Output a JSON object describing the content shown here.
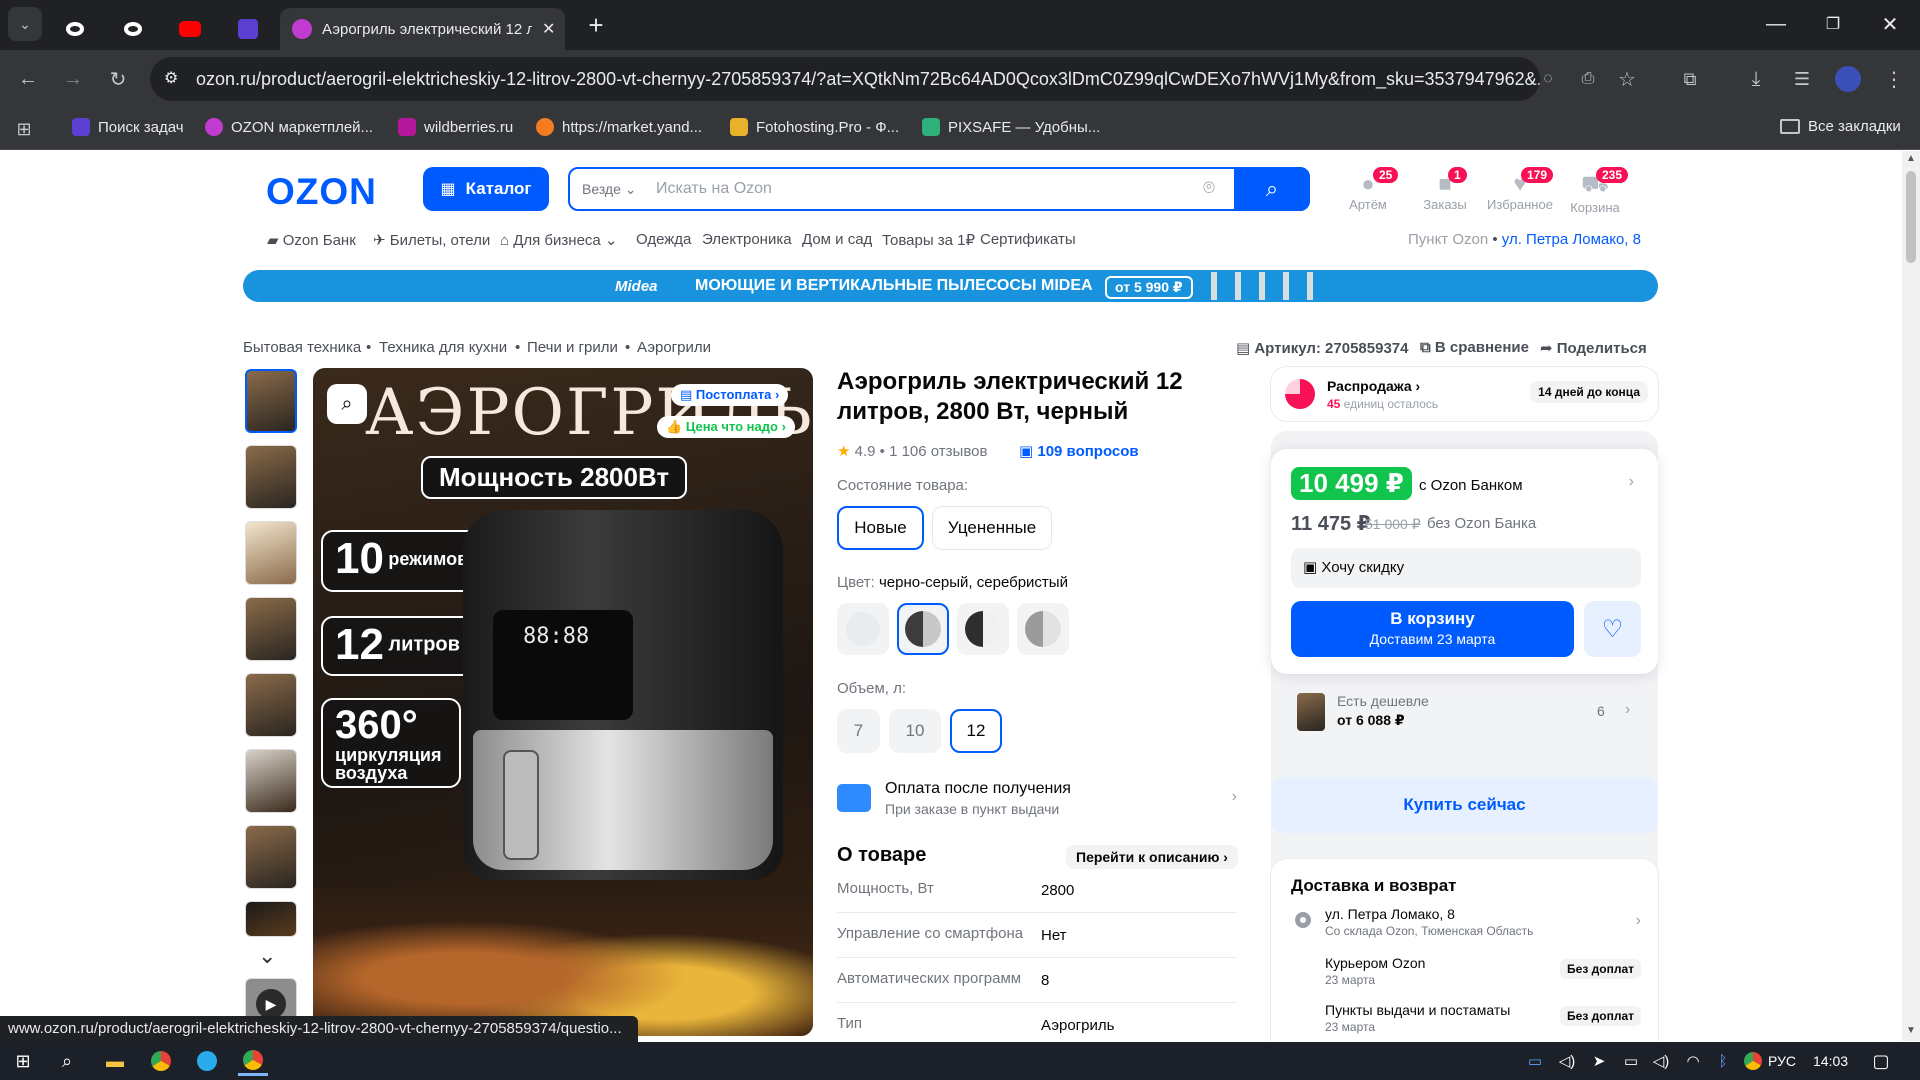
{
  "browser": {
    "tabs": [
      {
        "label": ""
      },
      {
        "label": ""
      },
      {
        "label": ""
      },
      {
        "label": ""
      },
      {
        "label": "Аэрогриль электрический 12 л"
      }
    ],
    "url": "ozon.ru/product/aerogril-elektricheskiy-12-litrov-2800-vt-chernyy-2705859374/?at=XQtkNm72Bc64AD0Qcox3lDmC0Z99qlCwDEXo7hWVj1My&from_sku=3537947962&...",
    "bookmarks": [
      {
        "label": "Поиск задач",
        "color": "#5b3fd1"
      },
      {
        "label": "OZON маркетплей...",
        "color": "#c23bd1"
      },
      {
        "label": "wildberries.ru",
        "color": "#b4169c"
      },
      {
        "label": "https://market.yand...",
        "color": "#f47b1f"
      },
      {
        "label": "Fotohosting.Pro - Ф...",
        "color": "#e8b12c"
      },
      {
        "label": "PIXSAFE — Удобны...",
        "color": "#2fb07a"
      }
    ],
    "all_bookmarks": "Все закладки",
    "status_url": "www.ozon.ru/product/aerogril-elektricheskiy-12-litrov-2800-vt-chernyy-2705859374/questio..."
  },
  "header": {
    "logo": "OZON",
    "catalog": "Каталог",
    "search_scope": "Везде",
    "search_placeholder": "Искать на Ozon",
    "icons": [
      {
        "label": "Артём",
        "badge": "25",
        "icon": "user-icon"
      },
      {
        "label": "Заказы",
        "badge": "1",
        "icon": "box-icon"
      },
      {
        "label": "Избранное",
        "badge": "179",
        "icon": "heart-icon"
      },
      {
        "label": "Корзина",
        "badge": "235",
        "icon": "cart-icon"
      }
    ],
    "nav": [
      "Ozon Банк",
      "Билеты, отели",
      "Для бизнеса",
      "Одежда",
      "Электроника",
      "Дом и сад",
      "Товары за 1₽",
      "Сертификаты"
    ],
    "pickup_label": "Пункт Ozon",
    "pickup_address": "ул. Петра Ломако, 8"
  },
  "banner": {
    "brand": "Midea",
    "text": "МОЮЩИЕ И ВЕРТИКАЛЬНЫЕ ПЫЛЕСОСЫ MIDEA",
    "price": "от 5 990 ₽"
  },
  "breadcrumbs": [
    "Бытовая техника",
    "Техника для кухни",
    "Печи и грили",
    "Аэрогрили"
  ],
  "top_actions": {
    "article": "Артикул: 2705859374",
    "compare": "В сравнение",
    "share": "Поделиться"
  },
  "gallery": {
    "badges": [
      "Постоплата",
      "Цена что надо"
    ],
    "overlay_title": "АЭРОГРИЛЬ",
    "features": [
      "Мощность 2800Вт",
      "10",
      "режимов работы",
      "12",
      "литров",
      "360°",
      "циркуляция воздуха"
    ],
    "display_digits": "88:88"
  },
  "product": {
    "title": "Аэрогриль электрический 12 литров, 2800 Вт, черный",
    "rating": "4.9",
    "reviews": "1 106 отзывов",
    "questions": "109 вопросов",
    "condition_label": "Состояние товара:",
    "conditions": [
      "Новые",
      "Уцененные"
    ],
    "color_label": "Цвет:",
    "color_value": "черно-серый, серебристый",
    "volume_label": "Объем, л:",
    "volumes": [
      "7",
      "10",
      "12"
    ],
    "payment_title": "Оплата после получения",
    "payment_sub": "При заказе в пункт выдачи",
    "about_title": "О товаре",
    "about_link": "Перейти к описанию",
    "specs": [
      {
        "key": "Мощность, Вт",
        "value": "2800"
      },
      {
        "key": "Управление со смартфона",
        "value": "Нет"
      },
      {
        "key": "Автоматических программ",
        "value": "8"
      },
      {
        "key": "Тип",
        "value": "Аэрогриль"
      }
    ]
  },
  "sale": {
    "title": "Распродажа",
    "count": "45",
    "count_suffix": "единиц осталось",
    "deadline": "14 дней до конца"
  },
  "price": {
    "bank_price": "10 499 ₽",
    "bank_label": "с Ozon Банком",
    "regular": "11 475 ₽",
    "old": "51 000 ₽",
    "no_bank_label": "без Ozon Банка",
    "discount_btn": "Хочу скидку",
    "cart_btn": "В корзину",
    "cart_sub": "Доставим 23 марта",
    "cheaper_label": "Есть дешевле",
    "cheaper_price": "от 6 088 ₽",
    "cheaper_count": "6",
    "buy_now": "Купить сейчас"
  },
  "delivery": {
    "title": "Доставка и возврат",
    "address": "ул. Петра Ломако, 8",
    "address_sub": "Со склада Ozon, Тюменская Область",
    "options": [
      {
        "name": "Курьером Ozon",
        "date": "23 марта",
        "tag": "Без доплат"
      },
      {
        "name": "Пункты выдачи и постаматы",
        "date": "23 марта",
        "tag": "Без доплат"
      }
    ]
  },
  "taskbar": {
    "lang": "РУС",
    "time": "14:03"
  }
}
